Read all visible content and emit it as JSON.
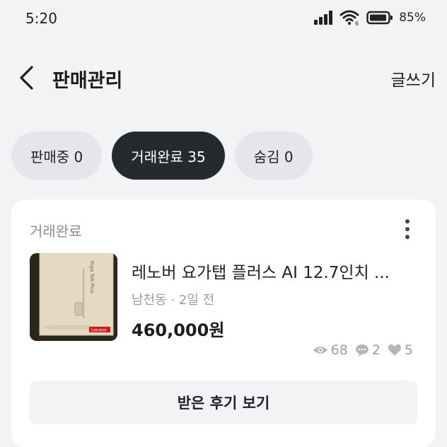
{
  "status_bar": {
    "time": "5:20",
    "battery_percent": "85%",
    "icons": [
      "signal-icon",
      "wifi-icon",
      "battery-icon"
    ]
  },
  "header": {
    "title": "판매관리",
    "write_label": "글쓰기"
  },
  "tabs": [
    {
      "label": "판매중 0",
      "active": false
    },
    {
      "label": "거래완료 35",
      "active": true
    },
    {
      "label": "숨김 0",
      "active": false
    }
  ],
  "item": {
    "status": "거래완료",
    "title": "레노버 요가탭 플러스 AI 12.7인치 ...",
    "location": "남천동",
    "time_ago": "2일 전",
    "meta": "남천동 · 2일 전",
    "price": "460,000원",
    "views": "68",
    "chats": "2",
    "likes": "5",
    "thumbnail_label": "Lenovo",
    "review_button": "받은 후기 보기"
  },
  "colors": {
    "background": "#f2f3f5",
    "active_tab": "#26292e",
    "inactive_tab": "#e4e6e9",
    "card": "#ffffff"
  }
}
